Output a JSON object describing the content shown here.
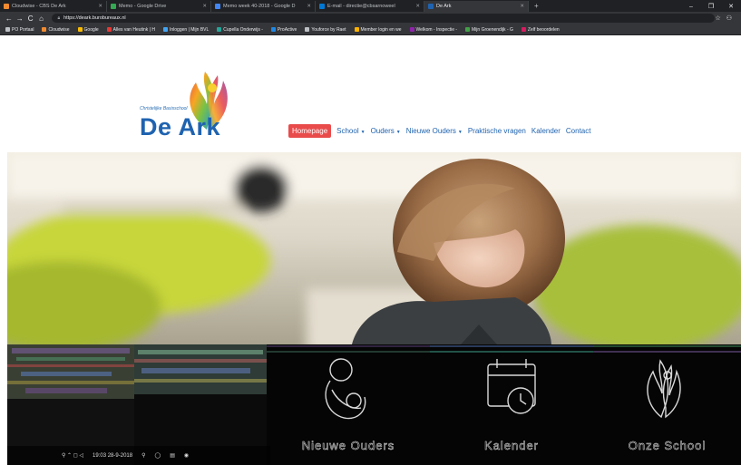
{
  "browser": {
    "tabs": [
      {
        "title": "Cloudwise - CBS De Ark",
        "favicon_color": "#f28b30",
        "active": false
      },
      {
        "title": "Memo - Google Drive",
        "favicon_color": "#34a853",
        "active": false
      },
      {
        "title": "Memo week 40-2018 - Google D",
        "favicon_color": "#4285f4",
        "active": false
      },
      {
        "title": "E-mail - directie@cbsarnoweel",
        "favicon_color": "#0078d4",
        "active": false
      },
      {
        "title": "De Ark",
        "favicon_color": "#1f63b0",
        "active": true
      }
    ],
    "new_tab_label": "+",
    "window_controls": [
      "–",
      "❐",
      "✕"
    ],
    "nav_buttons": [
      "←",
      "→",
      "C",
      "⌂"
    ],
    "url": "https://deark.burobureaux.nl",
    "toolbar_icons": [
      "☆",
      "⚇"
    ],
    "bookmarks": [
      {
        "label": "PO Portaal",
        "color": "#bdc1c6"
      },
      {
        "label": "Cloudwise",
        "color": "#f28b30"
      },
      {
        "label": "Google",
        "color": "#fbbc05"
      },
      {
        "label": "Alles van Heutink | H",
        "color": "#e53935"
      },
      {
        "label": "Inloggen | Mijn BVL",
        "color": "#42a5f5"
      },
      {
        "label": "Cupella Onderwijs -",
        "color": "#26a69a"
      },
      {
        "label": "ProActive",
        "color": "#1e88e5"
      },
      {
        "label": "Youforce by Raet",
        "color": "#bdc1c6"
      },
      {
        "label": "Member login en we",
        "color": "#ffb300"
      },
      {
        "label": "Welkom - Inspectie -",
        "color": "#8e24aa"
      },
      {
        "label": "Mijn Groenendijk - G",
        "color": "#43a047"
      },
      {
        "label": "Zelf beoordelen",
        "color": "#d81b60"
      }
    ]
  },
  "site": {
    "logo_tagline": "Christelijke Basisschool",
    "logo_name": "De Ark",
    "brand_color": "#1f63b0",
    "accent_color": "#e94b4b",
    "nav": [
      {
        "label": "Homepage",
        "active": true,
        "dropdown": false
      },
      {
        "label": "School",
        "active": false,
        "dropdown": true
      },
      {
        "label": "Ouders",
        "active": false,
        "dropdown": true
      },
      {
        "label": "Nieuwe Ouders",
        "active": false,
        "dropdown": true
      },
      {
        "label": "Praktische vragen",
        "active": false,
        "dropdown": false
      },
      {
        "label": "Kalender",
        "active": false,
        "dropdown": false
      },
      {
        "label": "Contact",
        "active": false,
        "dropdown": false
      }
    ],
    "tiles": [
      {
        "label": "",
        "icon": "none"
      },
      {
        "label": "",
        "icon": "none"
      },
      {
        "label": "Nieuwe Ouders",
        "icon": "mother-child-icon"
      },
      {
        "label": "Kalender",
        "icon": "calendar-clock-icon"
      },
      {
        "label": "Onze School",
        "icon": "logo-flame-icon"
      }
    ],
    "taskbar_clock": "19:03",
    "taskbar_date": "28-9-2018"
  }
}
